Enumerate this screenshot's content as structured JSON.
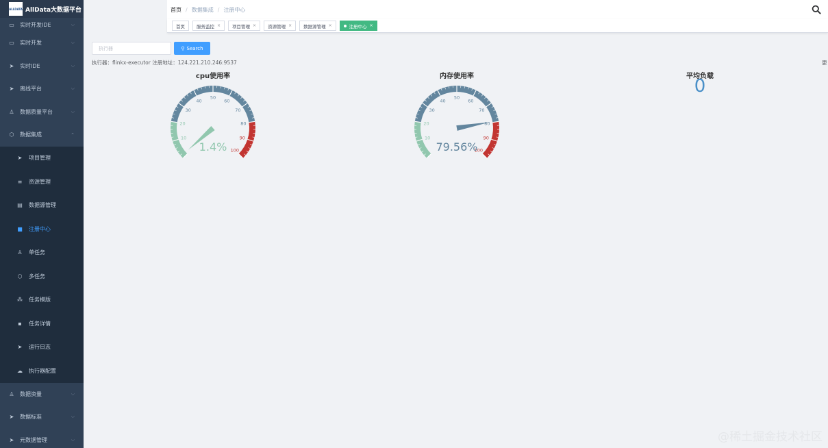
{
  "app": {
    "title": "AllData大数据平台",
    "logo_text": "ALLDATA"
  },
  "sidebar": {
    "items": [
      {
        "label": "实时开发IDE",
        "icon": "monitor-icon",
        "chevron": "⌵"
      },
      {
        "label": "实时开发",
        "icon": "monitor-icon",
        "chevron": "⌵"
      },
      {
        "label": "实时IDE",
        "icon": "send-icon",
        "chevron": "⌵"
      },
      {
        "label": "离线平台",
        "icon": "send-icon",
        "chevron": "⌵"
      },
      {
        "label": "数据质量平台",
        "icon": "user-icon",
        "chevron": "⌵"
      },
      {
        "label": "数据集成",
        "icon": "cube-icon",
        "chevron": "⌃"
      }
    ],
    "sub_items": [
      {
        "label": "项目管理",
        "icon": "send-icon"
      },
      {
        "label": "资源管理",
        "icon": "stack-icon"
      },
      {
        "label": "数据源管理",
        "icon": "database-icon"
      },
      {
        "label": "注册中心",
        "icon": "briefcase-icon",
        "active": true
      },
      {
        "label": "单任务",
        "icon": "user-icon"
      },
      {
        "label": "多任务",
        "icon": "cube-icon"
      },
      {
        "label": "任务模版",
        "icon": "cluster-icon"
      },
      {
        "label": "任务详情",
        "icon": "doc-icon"
      },
      {
        "label": "运行日志",
        "icon": "send-icon"
      },
      {
        "label": "执行器配置",
        "icon": "cloud-icon"
      }
    ],
    "bottom_items": [
      {
        "label": "数据资量",
        "icon": "user-icon",
        "chevron": "⌵"
      },
      {
        "label": "数据标准",
        "icon": "send-icon",
        "chevron": "⌵"
      },
      {
        "label": "元数据管理",
        "icon": "send-icon",
        "chevron": "⌵"
      }
    ]
  },
  "breadcrumb": {
    "items": [
      "首页",
      "数据集成",
      "注册中心"
    ],
    "separator": "/"
  },
  "tags": [
    {
      "label": "首页",
      "closable": false
    },
    {
      "label": "服务监控",
      "closable": true
    },
    {
      "label": "项目管理",
      "closable": true
    },
    {
      "label": "资源管理",
      "closable": true
    },
    {
      "label": "数据源管理",
      "closable": true
    },
    {
      "label": "注册中心",
      "closable": true,
      "active": true
    }
  ],
  "search": {
    "placeholder": "执行器",
    "button_label": "Search"
  },
  "executor_info": {
    "text": "执行器：flinkx-executor  注册地址：124.221.210.246:9537",
    "right_cut": "更"
  },
  "gauges": [
    {
      "title": "cpu使用率",
      "value": 1.4,
      "display": "1.4%"
    },
    {
      "title": "内存使用率",
      "value": 79.56,
      "display": "79.56%"
    }
  ],
  "gauge_ticks": [
    "10",
    "20",
    "30",
    "40",
    "50",
    "60",
    "70",
    "80",
    "90",
    "100"
  ],
  "average_load": {
    "title": "平均负载",
    "value": "0"
  },
  "colors": {
    "gauge_low": "#91c7ae",
    "gauge_mid": "#63869e",
    "gauge_high": "#c23531",
    "accent": "#409eff",
    "active_tag": "#42b983"
  },
  "watermark": "@稀土掘金技术社区"
}
